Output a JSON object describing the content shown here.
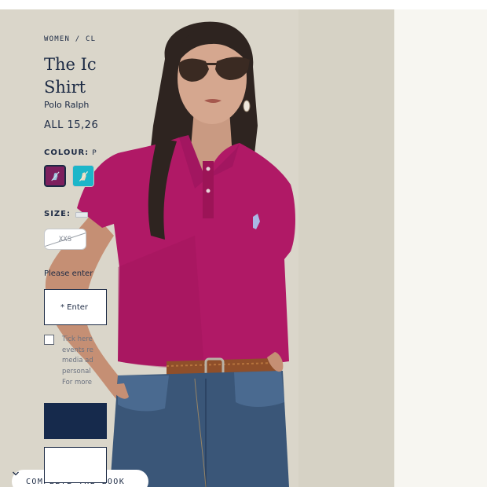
{
  "breadcrumb": "WOMEN / CL",
  "product": {
    "title_line1": "The Ic",
    "title_line2": "Shirt",
    "brand": "Polo Ralph",
    "price": "ALL 15,26"
  },
  "colour": {
    "label": "COLOUR:",
    "value": "P",
    "swatches": [
      {
        "name": "pink",
        "color": "#7d1f5e",
        "selected": true
      },
      {
        "name": "turquoise",
        "color": "#1cb6c9",
        "selected": false
      }
    ]
  },
  "size": {
    "label": "SIZE:",
    "options": [
      {
        "label": "XXS",
        "available": false
      }
    ]
  },
  "email_section": {
    "prompt": "Please enter",
    "input_placeholder": "* Enter",
    "consent_lines": [
      "Tick here",
      "events re",
      "media ad",
      "personal",
      "For more"
    ]
  },
  "photo": {
    "complete_the_look": "COMPLETE THE LOOK",
    "shirt_color": "#b01966"
  },
  "icons": [
    "chevron-down-icon",
    "pony-logo-icon",
    "size-guide-icon"
  ]
}
